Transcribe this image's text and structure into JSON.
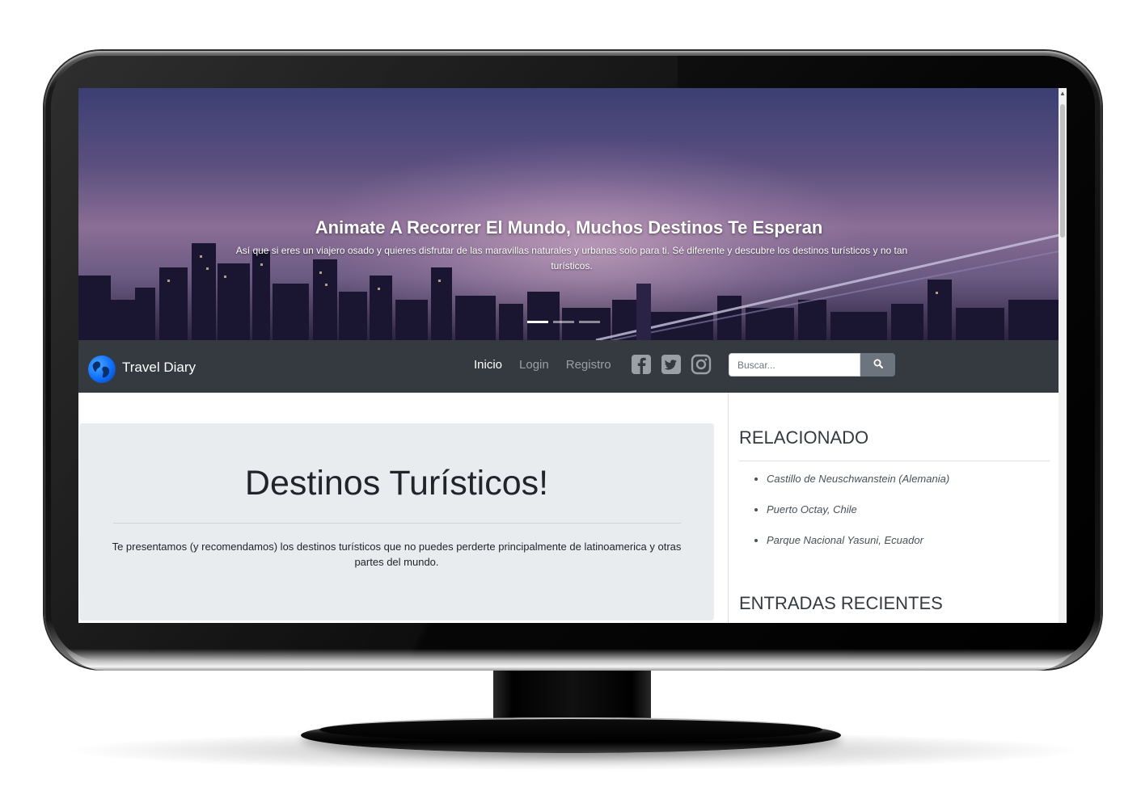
{
  "hero": {
    "title": "Animate A Recorrer El Mundo, Muchos Destinos Te Esperan",
    "subtitle": "Así que si eres un viajero osado y quieres disfrutar de las maravillas naturales y urbanas solo para ti. Sé diferente y descubre los destinos turísticos y no tan turísticos.",
    "active_slide": 1,
    "slide_count": 3
  },
  "navbar": {
    "brand": "Travel Diary",
    "links": [
      {
        "label": "Inicio",
        "active": true
      },
      {
        "label": "Login",
        "active": false
      },
      {
        "label": "Registro",
        "active": false
      }
    ],
    "social_icons": [
      "facebook-icon",
      "twitter-icon",
      "instagram-icon"
    ],
    "search": {
      "placeholder": "Buscar...",
      "value": "",
      "button_icon": "search-icon"
    }
  },
  "main": {
    "title": "Destinos Turísticos!",
    "text": "Te presentamos (y recomendamos) los destinos turísticos que no puedes perderte principalmente de latinoamerica y otras partes del mundo."
  },
  "sidebar": {
    "related_heading": "RELACIONADO",
    "related": [
      "Castillo de Neuschwanstein (Alemania)",
      "Puerto Octay, Chile",
      "Parque Nacional Yasuni, Ecuador"
    ],
    "recent_heading": "ENTRADAS RECIENTES"
  },
  "colors": {
    "navbar_bg": "#343a40",
    "jumbotron_bg": "#e9ecef",
    "search_button": "#6c757d"
  }
}
